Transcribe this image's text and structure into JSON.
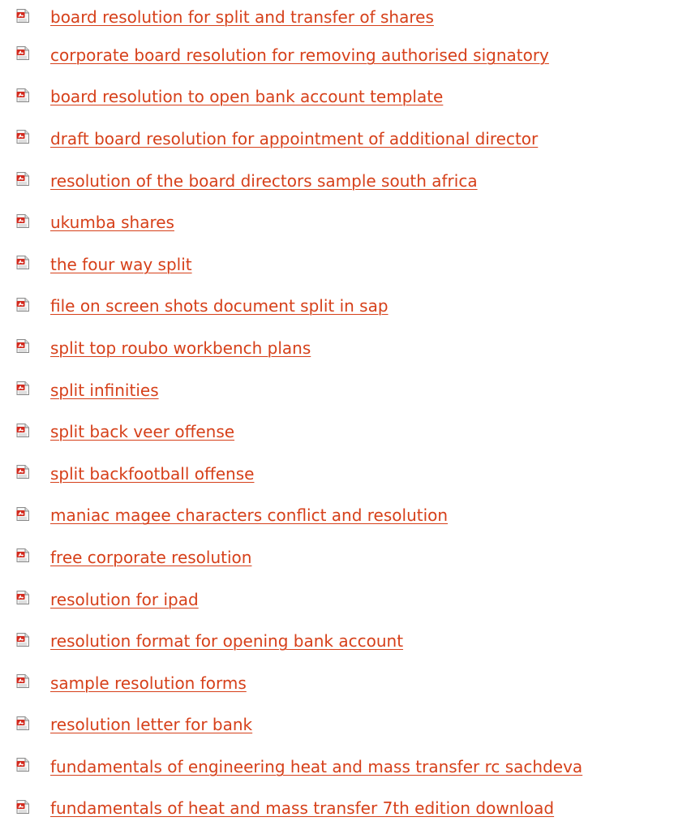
{
  "link_color": "#d6401a",
  "icon": "pdf-file-icon",
  "links": [
    {
      "label": "board resolution for split and transfer of shares"
    },
    {
      "label": "corporate board resolution for removing authorised signatory"
    },
    {
      "label": "board resolution to open bank account template"
    },
    {
      "label": "draft board resolution for appointment of additional director"
    },
    {
      "label": "resolution of the board directors sample south africa"
    },
    {
      "label": "ukumba shares"
    },
    {
      "label": "the four way split"
    },
    {
      "label": "file on screen shots document split in sap"
    },
    {
      "label": "split top roubo workbench plans"
    },
    {
      "label": "split infinities"
    },
    {
      "label": "split back veer offense"
    },
    {
      "label": "split backfootball offense"
    },
    {
      "label": "maniac magee characters conflict and resolution"
    },
    {
      "label": "free corporate resolution"
    },
    {
      "label": "resolution for ipad"
    },
    {
      "label": "resolution format for opening bank account"
    },
    {
      "label": "sample resolution forms"
    },
    {
      "label": "resolution letter for bank"
    },
    {
      "label": "fundamentals of engineering heat and mass transfer rc sachdeva"
    },
    {
      "label": "fundamentals of heat and mass transfer 7th edition download"
    }
  ]
}
